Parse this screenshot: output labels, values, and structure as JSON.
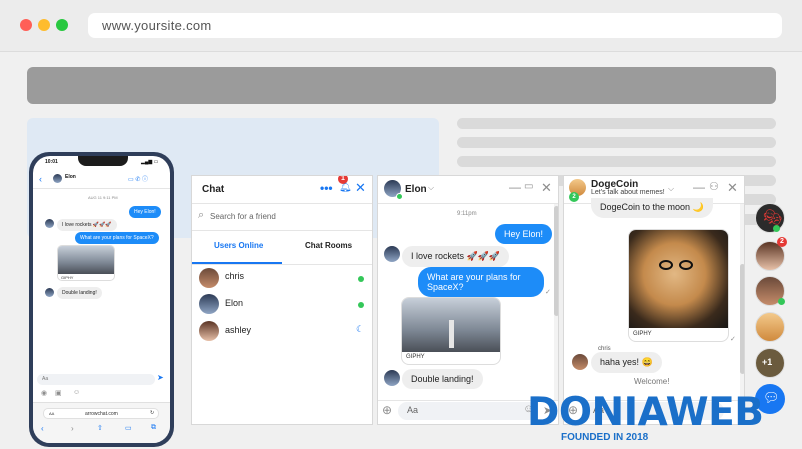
{
  "browser": {
    "url": "www.yoursite.com"
  },
  "friends_panel": {
    "title": "Chat",
    "notification_count": "1",
    "search_placeholder": "Search for a friend",
    "tabs": [
      "Users Online",
      "Chat Rooms"
    ],
    "users": [
      {
        "name": "chris",
        "status": "online"
      },
      {
        "name": "Elon",
        "status": "online"
      },
      {
        "name": "ashley",
        "status": "away"
      }
    ]
  },
  "elon_chat": {
    "title": "Elon",
    "time": "9:11pm",
    "messages": {
      "m1": "Hey Elon!",
      "m2": "I love rockets 🚀🚀🚀",
      "m3": "What are your plans for SpaceX?",
      "m4": "GIPHY",
      "m5": "Double landing!"
    },
    "input_placeholder": "Aa"
  },
  "doge_chat": {
    "title": "DogeCoin",
    "subtitle": "Let's talk about memes!",
    "member_count": "2",
    "messages": {
      "m1": "DogeCoin to the moon 🌙",
      "gif_label": "GIPHY",
      "sender": "chris",
      "m2": "haha yes! 😄",
      "system": "Welcome!"
    },
    "input_placeholder": "Aa"
  },
  "sidebar": {
    "badge_2": "2",
    "badge_more": "+1"
  },
  "phone": {
    "time": "10:01",
    "contact": "Elon",
    "date": "AUG 11 9:11 PM",
    "messages": {
      "m1": "Hey Elon!",
      "m2": "I love rockets 🚀🚀🚀",
      "m3": "What are your plans for SpaceX?",
      "m4": "GIPHY",
      "m5": "Double landing!"
    },
    "input_placeholder": "Aa",
    "url": "arrowchat.com",
    "aa": "AA"
  },
  "watermark": {
    "brand": "DONIAWEB",
    "tagline": "FOUNDED IN 2018"
  },
  "colors": {
    "accent": "#1877f2",
    "bubble_out": "#1d8cf8",
    "online": "#34c759",
    "brand": "#1a6fc9"
  }
}
